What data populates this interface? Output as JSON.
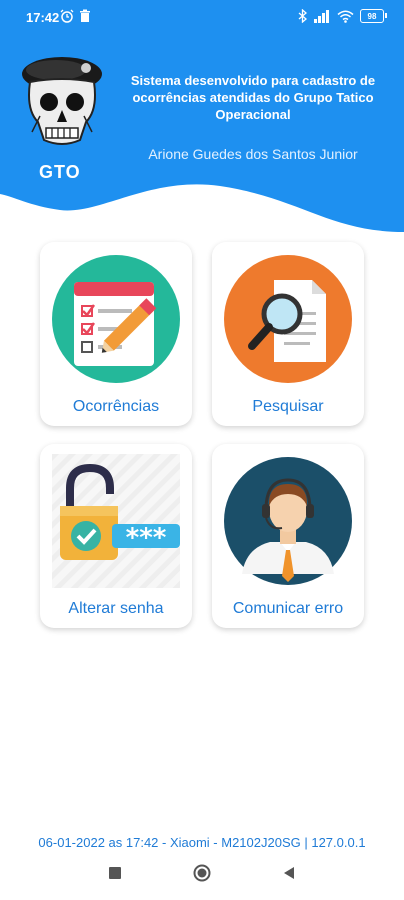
{
  "status_bar": {
    "time": "17:42",
    "battery": "98",
    "icons": [
      "alarm-icon",
      "trash-icon",
      "bluetooth-icon",
      "signal-icon",
      "wifi-icon",
      "battery-icon"
    ]
  },
  "header": {
    "logo_text": "GTO",
    "description": "Sistema desenvolvido para cadastro de ocorrências atendidas do Grupo Tatico Operacional",
    "author": "Arione Guedes dos Santos Junior"
  },
  "menu": {
    "ocorrencias": {
      "label": "Ocorrências",
      "icon": "checklist-icon"
    },
    "pesquisar": {
      "label": "Pesquisar",
      "icon": "magnifier-document-icon"
    },
    "alterar_senha": {
      "label": "Alterar senha",
      "icon": "padlock-password-icon"
    },
    "comunicar_erro": {
      "label": "Comunicar erro",
      "icon": "support-agent-icon"
    }
  },
  "footer": {
    "info": "06-01-2022 as 17:42 - Xiaomi - M2102J20SG | 127.0.0.1"
  },
  "colors": {
    "header_blue": "#1e90f0",
    "label_blue": "#1f7bd6",
    "teal": "#24b89a",
    "orange": "#ee7a2d",
    "dark_teal": "#1b4f69"
  }
}
